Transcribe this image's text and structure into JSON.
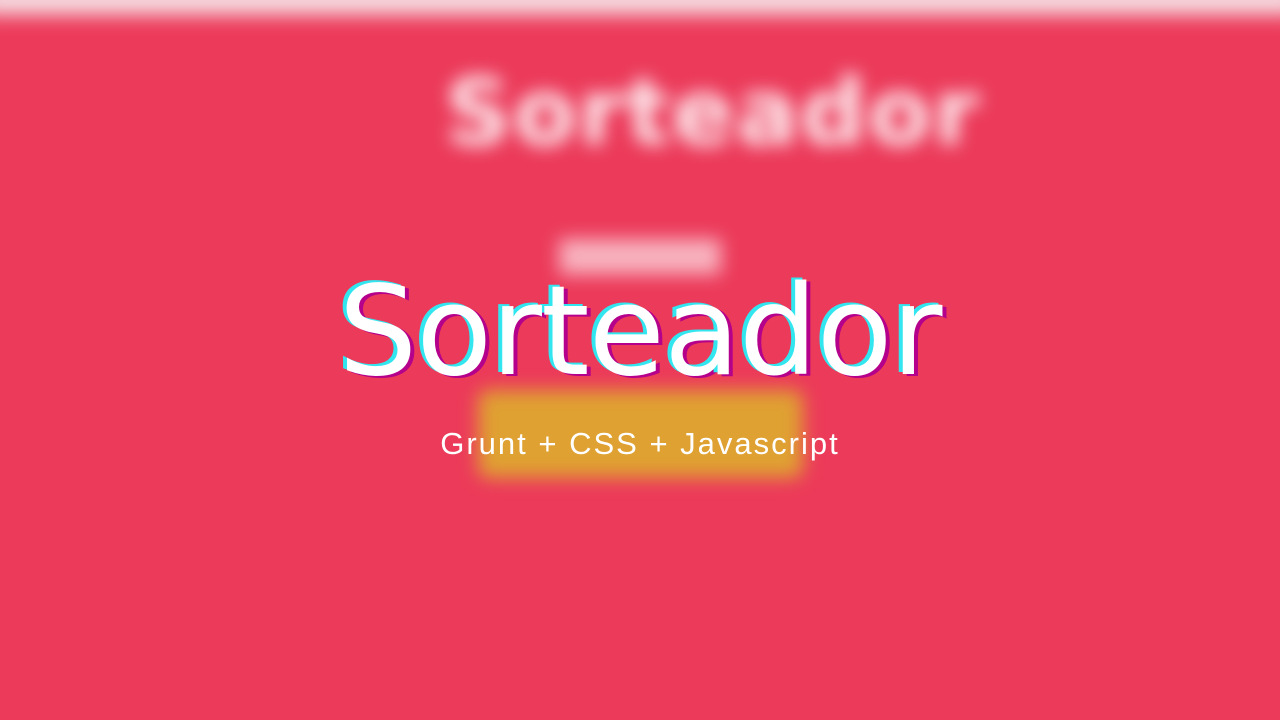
{
  "colors": {
    "background": "#ec3a5a",
    "button": "#dfa132",
    "title": "#ffffff",
    "title_shadow_cyan": "#32e6ef",
    "title_shadow_magenta": "#b4008a"
  },
  "backdrop": {
    "title": "Sorteador"
  },
  "overlay": {
    "title": "Sorteador",
    "subtitle": "Grunt + CSS + Javascript"
  }
}
